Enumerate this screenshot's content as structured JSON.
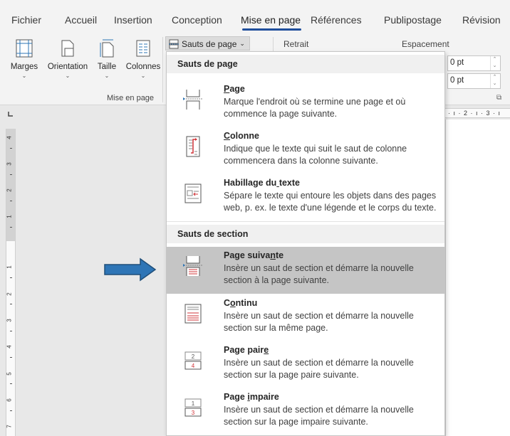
{
  "tabs": [
    {
      "label": "Fichier",
      "active": false
    },
    {
      "label": "Accueil",
      "active": false
    },
    {
      "label": "Insertion",
      "active": false
    },
    {
      "label": "Conception",
      "active": false
    },
    {
      "label": "Mise en page",
      "active": true
    },
    {
      "label": "Références",
      "active": false
    },
    {
      "label": "Publipostage",
      "active": false
    },
    {
      "label": "Révision",
      "active": false
    }
  ],
  "ribbon": {
    "buttons": [
      {
        "label": "Marges",
        "icon": "margins-icon"
      },
      {
        "label": "Orientation",
        "icon": "orientation-icon"
      },
      {
        "label": "Taille",
        "icon": "size-icon"
      },
      {
        "label": "Colonnes",
        "icon": "columns-icon"
      }
    ],
    "group_label": "Mise en page",
    "breaks_label": "Sauts de page",
    "retrait_label": "Retrait",
    "espacement_label": "Espacement",
    "spacing_before": "0 pt",
    "spacing_after": "0 pt"
  },
  "ruler": {
    "horizontal": "· ı · 2 · ı · 3 · ı",
    "vertical": [
      "4",
      "3",
      "2",
      "1",
      "1",
      "2",
      "3",
      "4",
      "5",
      "6",
      "7"
    ]
  },
  "menu": {
    "section1_heading": "Sauts de page",
    "section2_heading": "Sauts de section",
    "page_breaks": [
      {
        "title": "Page",
        "accel_index": 0,
        "desc": "Marque l'endroit où se termine une page et où commence la page suivante.",
        "icon": "page-break-icon"
      },
      {
        "title": "Colonne",
        "accel_index": 0,
        "desc": "Indique que le texte qui suit le saut de colonne commencera dans la colonne suivante.",
        "icon": "column-break-icon"
      },
      {
        "title": "Habillage du texte",
        "accel_index": 12,
        "desc": "Sépare le texte qui entoure les objets dans des pages web, p. ex. le texte d'une légende et le corps du texte.",
        "icon": "text-wrapping-icon"
      }
    ],
    "section_breaks": [
      {
        "title": "Page suivante",
        "accel_index": 10,
        "desc": "Insère un saut de section et démarre la nouvelle section à la page suivante.",
        "icon": "next-page-section-icon",
        "highlighted": true
      },
      {
        "title": "Continu",
        "accel_index": 1,
        "desc": "Insère un saut de section et démarre la nouvelle section sur la même page.",
        "icon": "continuous-section-icon",
        "highlighted": false
      },
      {
        "title": "Page paire",
        "accel_index": 9,
        "desc": "Insère un saut de section et démarre la nouvelle section sur la page paire suivante.",
        "icon": "even-page-section-icon",
        "highlighted": false
      },
      {
        "title": "Page impaire",
        "accel_index": 5,
        "desc": "Insère un saut de section et démarre la nouvelle section sur la page impaire suivante.",
        "icon": "odd-page-section-icon",
        "highlighted": false
      }
    ]
  },
  "colors": {
    "accent": "#1f4e9c",
    "arrow_fill": "#2e75b6",
    "arrow_stroke": "#1f4e79",
    "highlight": "#c5c5c5",
    "break_red": "#d13438"
  }
}
